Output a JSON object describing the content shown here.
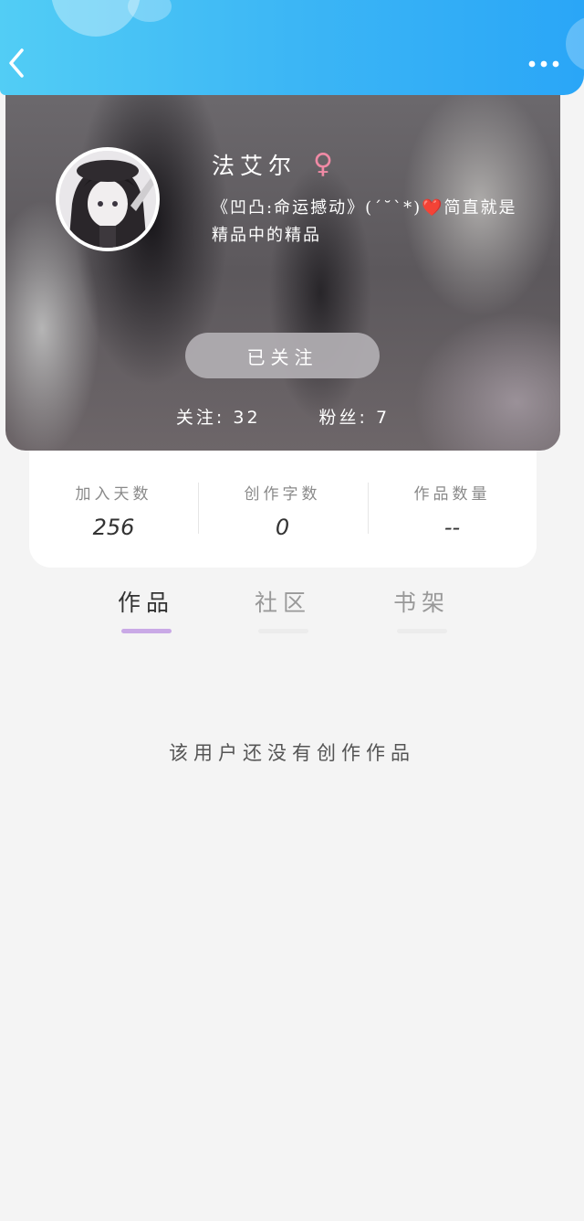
{
  "header": {
    "back_icon": "chevron-left-icon",
    "more_icon": "more-horizontal-icon",
    "accent": "#3cb6f5"
  },
  "profile": {
    "username": "法艾尔",
    "gender_symbol": "♀",
    "gender_color": "#f08aa5",
    "bio": "《凹凸:命运撼动》(´˘`*)❤️简直就是精品中的精品",
    "follow_button_label": "已关注",
    "following_text": "关注: 32",
    "followers_text": "粉丝: 7"
  },
  "stats": [
    {
      "label": "加入天数",
      "value": "256"
    },
    {
      "label": "创作字数",
      "value": "0"
    },
    {
      "label": "作品数量",
      "value": "--"
    }
  ],
  "tabs": [
    {
      "label": "作品",
      "active": true
    },
    {
      "label": "社区",
      "active": false
    },
    {
      "label": "书架",
      "active": false
    }
  ],
  "tab_accent": "#c9a9e6",
  "empty_message": "该用户还没有创作作品"
}
